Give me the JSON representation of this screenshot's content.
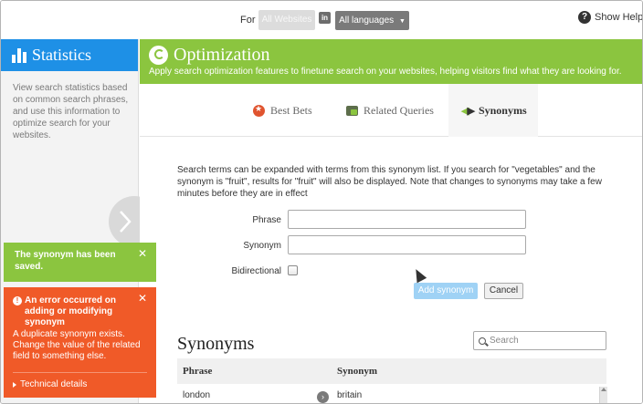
{
  "topbar": {
    "for_label": "For",
    "websites_label": "All Websites",
    "badge_label": "in",
    "language_label": "All languages",
    "help_label": "Show Help"
  },
  "left_panel": {
    "title": "Statistics",
    "description": "View search statistics based on common search phrases, and use this information to optimize search for your websites."
  },
  "notifications": {
    "success": {
      "message": "The synonym has been saved."
    },
    "error": {
      "title": "An error occurred on adding or modifying synonym",
      "body": "A duplicate synonym exists. Change the value of the related field to something else.",
      "details_label": "Technical details"
    }
  },
  "main": {
    "title": "Optimization",
    "subtitle": "Apply search optimization features to finetune search on your websites, helping visitors find what they are looking for.",
    "tabs": [
      {
        "label": "Best Bets",
        "active": false
      },
      {
        "label": "Related Queries",
        "active": false
      },
      {
        "label": "Synonyms",
        "active": true
      }
    ],
    "description": "Search terms can be expanded with terms from this synonym list. If you search for \"vegetables\" and the synonym is \"fruit\", results for \"fruit\" will also be displayed. Note that changes to synonyms may take a few minutes before they are in effect",
    "form": {
      "phrase_label": "Phrase",
      "phrase_value": "",
      "synonym_label": "Synonym",
      "synonym_value": "",
      "bidirectional_label": "Bidirectional",
      "add_label": "Add synonym",
      "cancel_label": "Cancel"
    },
    "list": {
      "heading": "Synonyms",
      "search_placeholder": "Search",
      "columns": [
        "Phrase",
        "Synonym"
      ],
      "rows": [
        {
          "phrase": "london",
          "synonym": "britain"
        }
      ]
    }
  },
  "colors": {
    "accent_green": "#8bc53f",
    "accent_blue": "#1e90e6",
    "error_red": "#f05a28"
  }
}
